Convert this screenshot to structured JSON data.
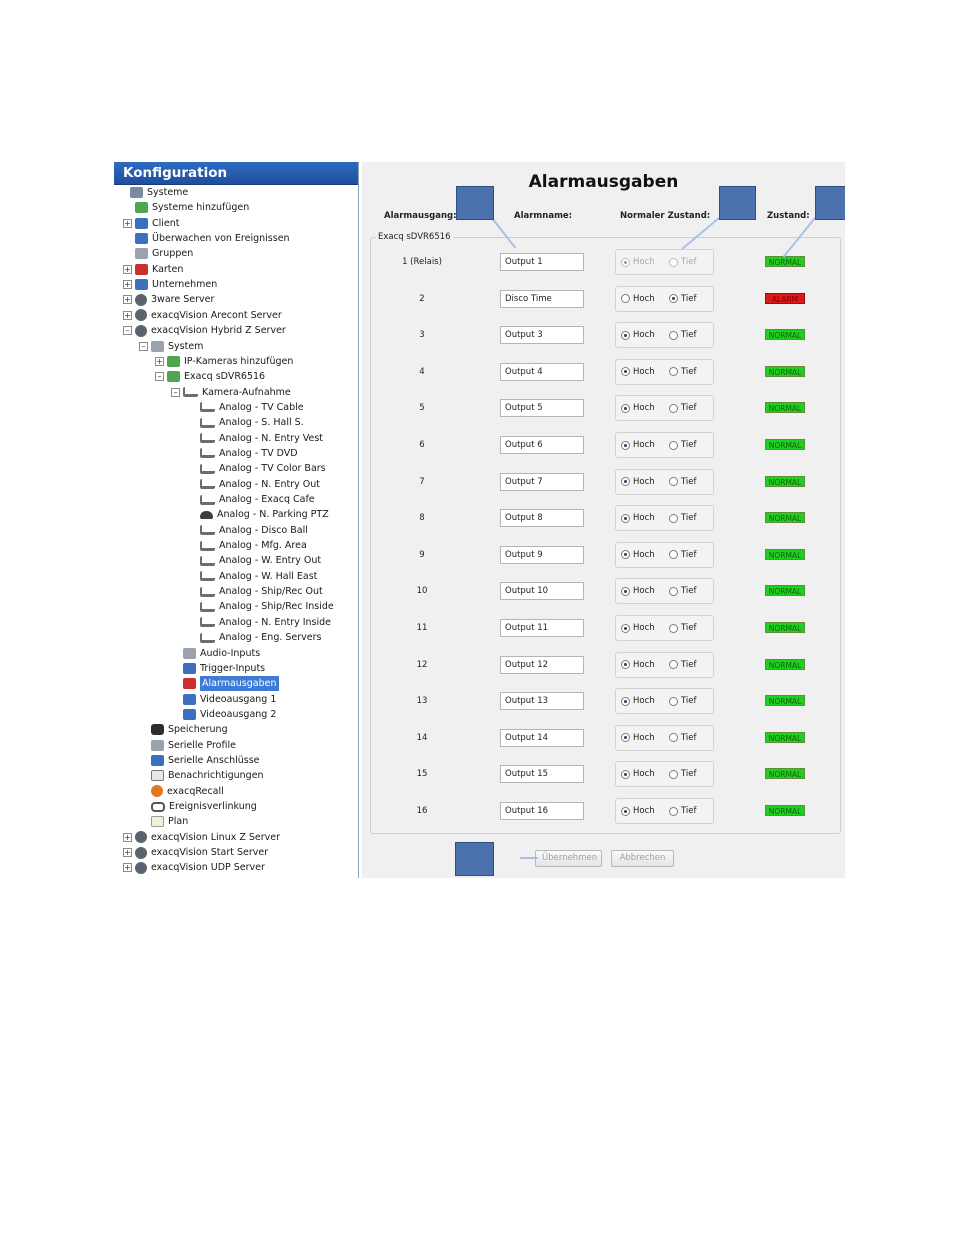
{
  "sidebar": {
    "title": "Konfiguration",
    "items": [
      {
        "label": "Systeme",
        "level": 0,
        "toggle": "",
        "icon": "systems-icon"
      },
      {
        "label": "Systeme hinzufügen",
        "level": 1,
        "toggle": "",
        "icon": "add-systems-icon"
      },
      {
        "label": "Client",
        "level": 1,
        "toggle": "+",
        "icon": "client-gear-icon"
      },
      {
        "label": "Überwachen von Ereignissen",
        "level": 1,
        "toggle": "",
        "icon": "event-monitor-icon"
      },
      {
        "label": "Gruppen",
        "level": 1,
        "toggle": "",
        "icon": "groups-icon"
      },
      {
        "label": "Karten",
        "level": 1,
        "toggle": "+",
        "icon": "map-pin-icon"
      },
      {
        "label": "Unternehmen",
        "level": 1,
        "toggle": "+",
        "icon": "enterprise-icon"
      },
      {
        "label": "3ware Server",
        "level": 1,
        "toggle": "+",
        "icon": "server-icon"
      },
      {
        "label": "exacqVision Arecont Server",
        "level": 1,
        "toggle": "+",
        "icon": "server-icon"
      },
      {
        "label": "exacqVision Hybrid Z Server",
        "level": 1,
        "toggle": "-",
        "icon": "server-icon"
      },
      {
        "label": "System",
        "level": 2,
        "toggle": "-",
        "icon": "system-icon"
      },
      {
        "label": "IP-Kameras hinzufügen",
        "level": 3,
        "toggle": "+",
        "icon": "ip-camera-icon"
      },
      {
        "label": "Exacq sDVR6516",
        "level": 3,
        "toggle": "-",
        "icon": "dvr-card-icon"
      },
      {
        "label": "Kamera-Aufnahme",
        "level": 4,
        "toggle": "-",
        "icon": "camera-icon"
      },
      {
        "label": "Analog - TV Cable",
        "level": 5,
        "toggle": "",
        "icon": "camera-icon"
      },
      {
        "label": "Analog - S. Hall S.",
        "level": 5,
        "toggle": "",
        "icon": "camera-icon"
      },
      {
        "label": "Analog - N. Entry Vest",
        "level": 5,
        "toggle": "",
        "icon": "camera-icon"
      },
      {
        "label": "Analog - TV DVD",
        "level": 5,
        "toggle": "",
        "icon": "camera-icon"
      },
      {
        "label": "Analog - TV Color Bars",
        "level": 5,
        "toggle": "",
        "icon": "camera-icon"
      },
      {
        "label": "Analog - N. Entry Out",
        "level": 5,
        "toggle": "",
        "icon": "camera-icon"
      },
      {
        "label": "Analog - Exacq Cafe",
        "level": 5,
        "toggle": "",
        "icon": "camera-icon"
      },
      {
        "label": "Analog - N. Parking PTZ",
        "level": 5,
        "toggle": "",
        "icon": "ptz-dome-icon"
      },
      {
        "label": "Analog - Disco Ball",
        "level": 5,
        "toggle": "",
        "icon": "camera-icon"
      },
      {
        "label": "Analog - Mfg. Area",
        "level": 5,
        "toggle": "",
        "icon": "camera-icon"
      },
      {
        "label": "Analog - W. Entry Out",
        "level": 5,
        "toggle": "",
        "icon": "camera-icon"
      },
      {
        "label": "Analog - W. Hall East",
        "level": 5,
        "toggle": "",
        "icon": "camera-icon"
      },
      {
        "label": "Analog - Ship/Rec Out",
        "level": 5,
        "toggle": "",
        "icon": "camera-icon"
      },
      {
        "label": "Analog - Ship/Rec Inside",
        "level": 5,
        "toggle": "",
        "icon": "camera-icon"
      },
      {
        "label": "Analog - N. Entry Inside",
        "level": 5,
        "toggle": "",
        "icon": "camera-icon"
      },
      {
        "label": "Analog - Eng. Servers",
        "level": 5,
        "toggle": "",
        "icon": "camera-icon"
      },
      {
        "label": "Audio-Inputs",
        "level": 4,
        "toggle": "",
        "icon": "speaker-icon"
      },
      {
        "label": "Trigger-Inputs",
        "level": 4,
        "toggle": "",
        "icon": "trigger-icon"
      },
      {
        "label": "Alarmausgaben",
        "level": 4,
        "toggle": "",
        "icon": "alarm-output-icon",
        "selected": true
      },
      {
        "label": "Videoausgang 1",
        "level": 4,
        "toggle": "",
        "icon": "video-output-icon"
      },
      {
        "label": "Videoausgang 2",
        "level": 4,
        "toggle": "",
        "icon": "video-output-icon"
      },
      {
        "label": "Speicherung",
        "level": 2,
        "toggle": "",
        "icon": "storage-icon"
      },
      {
        "label": "Serielle Profile",
        "level": 2,
        "toggle": "",
        "icon": "serial-profile-icon"
      },
      {
        "label": "Serielle Anschlüsse",
        "level": 2,
        "toggle": "",
        "icon": "serial-port-icon"
      },
      {
        "label": "Benachrichtigungen",
        "level": 2,
        "toggle": "",
        "icon": "mail-icon"
      },
      {
        "label": "exacqRecall",
        "level": 2,
        "toggle": "",
        "icon": "recall-icon"
      },
      {
        "label": "Ereignisverlinkung",
        "level": 2,
        "toggle": "",
        "icon": "link-icon"
      },
      {
        "label": "Plan",
        "level": 2,
        "toggle": "",
        "icon": "schedule-icon"
      },
      {
        "label": "exacqVision Linux Z Server",
        "level": 1,
        "toggle": "+",
        "icon": "server-icon"
      },
      {
        "label": "exacqVision Start Server",
        "level": 1,
        "toggle": "+",
        "icon": "server-icon"
      },
      {
        "label": "exacqVision UDP Server",
        "level": 1,
        "toggle": "+",
        "icon": "server-icon"
      }
    ]
  },
  "main": {
    "title": "Alarmausgaben",
    "columns": {
      "output": "Alarmausgang:",
      "name": "Alarmname:",
      "normal_state": "Normaler Zustand:",
      "state": "Zustand:"
    },
    "group_label": "Exacq sDVR6516",
    "radio_labels": {
      "high": "Hoch",
      "low": "Tief"
    },
    "rows": [
      {
        "num": "1 (Relais)",
        "name": "Output 1",
        "normal": "high",
        "disabled": true,
        "status": "NORMAL"
      },
      {
        "num": "2",
        "name": "Disco Time",
        "normal": "low",
        "disabled": false,
        "status": "ALARM"
      },
      {
        "num": "3",
        "name": "Output 3",
        "normal": "high",
        "disabled": false,
        "status": "NORMAL"
      },
      {
        "num": "4",
        "name": "Output 4",
        "normal": "high",
        "disabled": false,
        "status": "NORMAL"
      },
      {
        "num": "5",
        "name": "Output 5",
        "normal": "high",
        "disabled": false,
        "status": "NORMAL"
      },
      {
        "num": "6",
        "name": "Output 6",
        "normal": "high",
        "disabled": false,
        "status": "NORMAL"
      },
      {
        "num": "7",
        "name": "Output 7",
        "normal": "high",
        "disabled": false,
        "status": "NORMAL"
      },
      {
        "num": "8",
        "name": "Output 8",
        "normal": "high",
        "disabled": false,
        "status": "NORMAL"
      },
      {
        "num": "9",
        "name": "Output 9",
        "normal": "high",
        "disabled": false,
        "status": "NORMAL"
      },
      {
        "num": "10",
        "name": "Output 10",
        "normal": "high",
        "disabled": false,
        "status": "NORMAL"
      },
      {
        "num": "11",
        "name": "Output 11",
        "normal": "high",
        "disabled": false,
        "status": "NORMAL"
      },
      {
        "num": "12",
        "name": "Output 12",
        "normal": "high",
        "disabled": false,
        "status": "NORMAL"
      },
      {
        "num": "13",
        "name": "Output 13",
        "normal": "high",
        "disabled": false,
        "status": "NORMAL"
      },
      {
        "num": "14",
        "name": "Output 14",
        "normal": "high",
        "disabled": false,
        "status": "NORMAL"
      },
      {
        "num": "15",
        "name": "Output 15",
        "normal": "high",
        "disabled": false,
        "status": "NORMAL"
      },
      {
        "num": "16",
        "name": "Output 16",
        "normal": "high",
        "disabled": false,
        "status": "NORMAL"
      }
    ],
    "buttons": {
      "apply": "Übernehmen",
      "cancel": "Abbrechen"
    }
  },
  "colors": {
    "header_blue": "#2f6bc2",
    "selection_blue": "#3d7bd6",
    "status_normal": "#1fd11f",
    "status_alarm": "#dd1a1a",
    "callout_blue": "#4b72ad"
  }
}
